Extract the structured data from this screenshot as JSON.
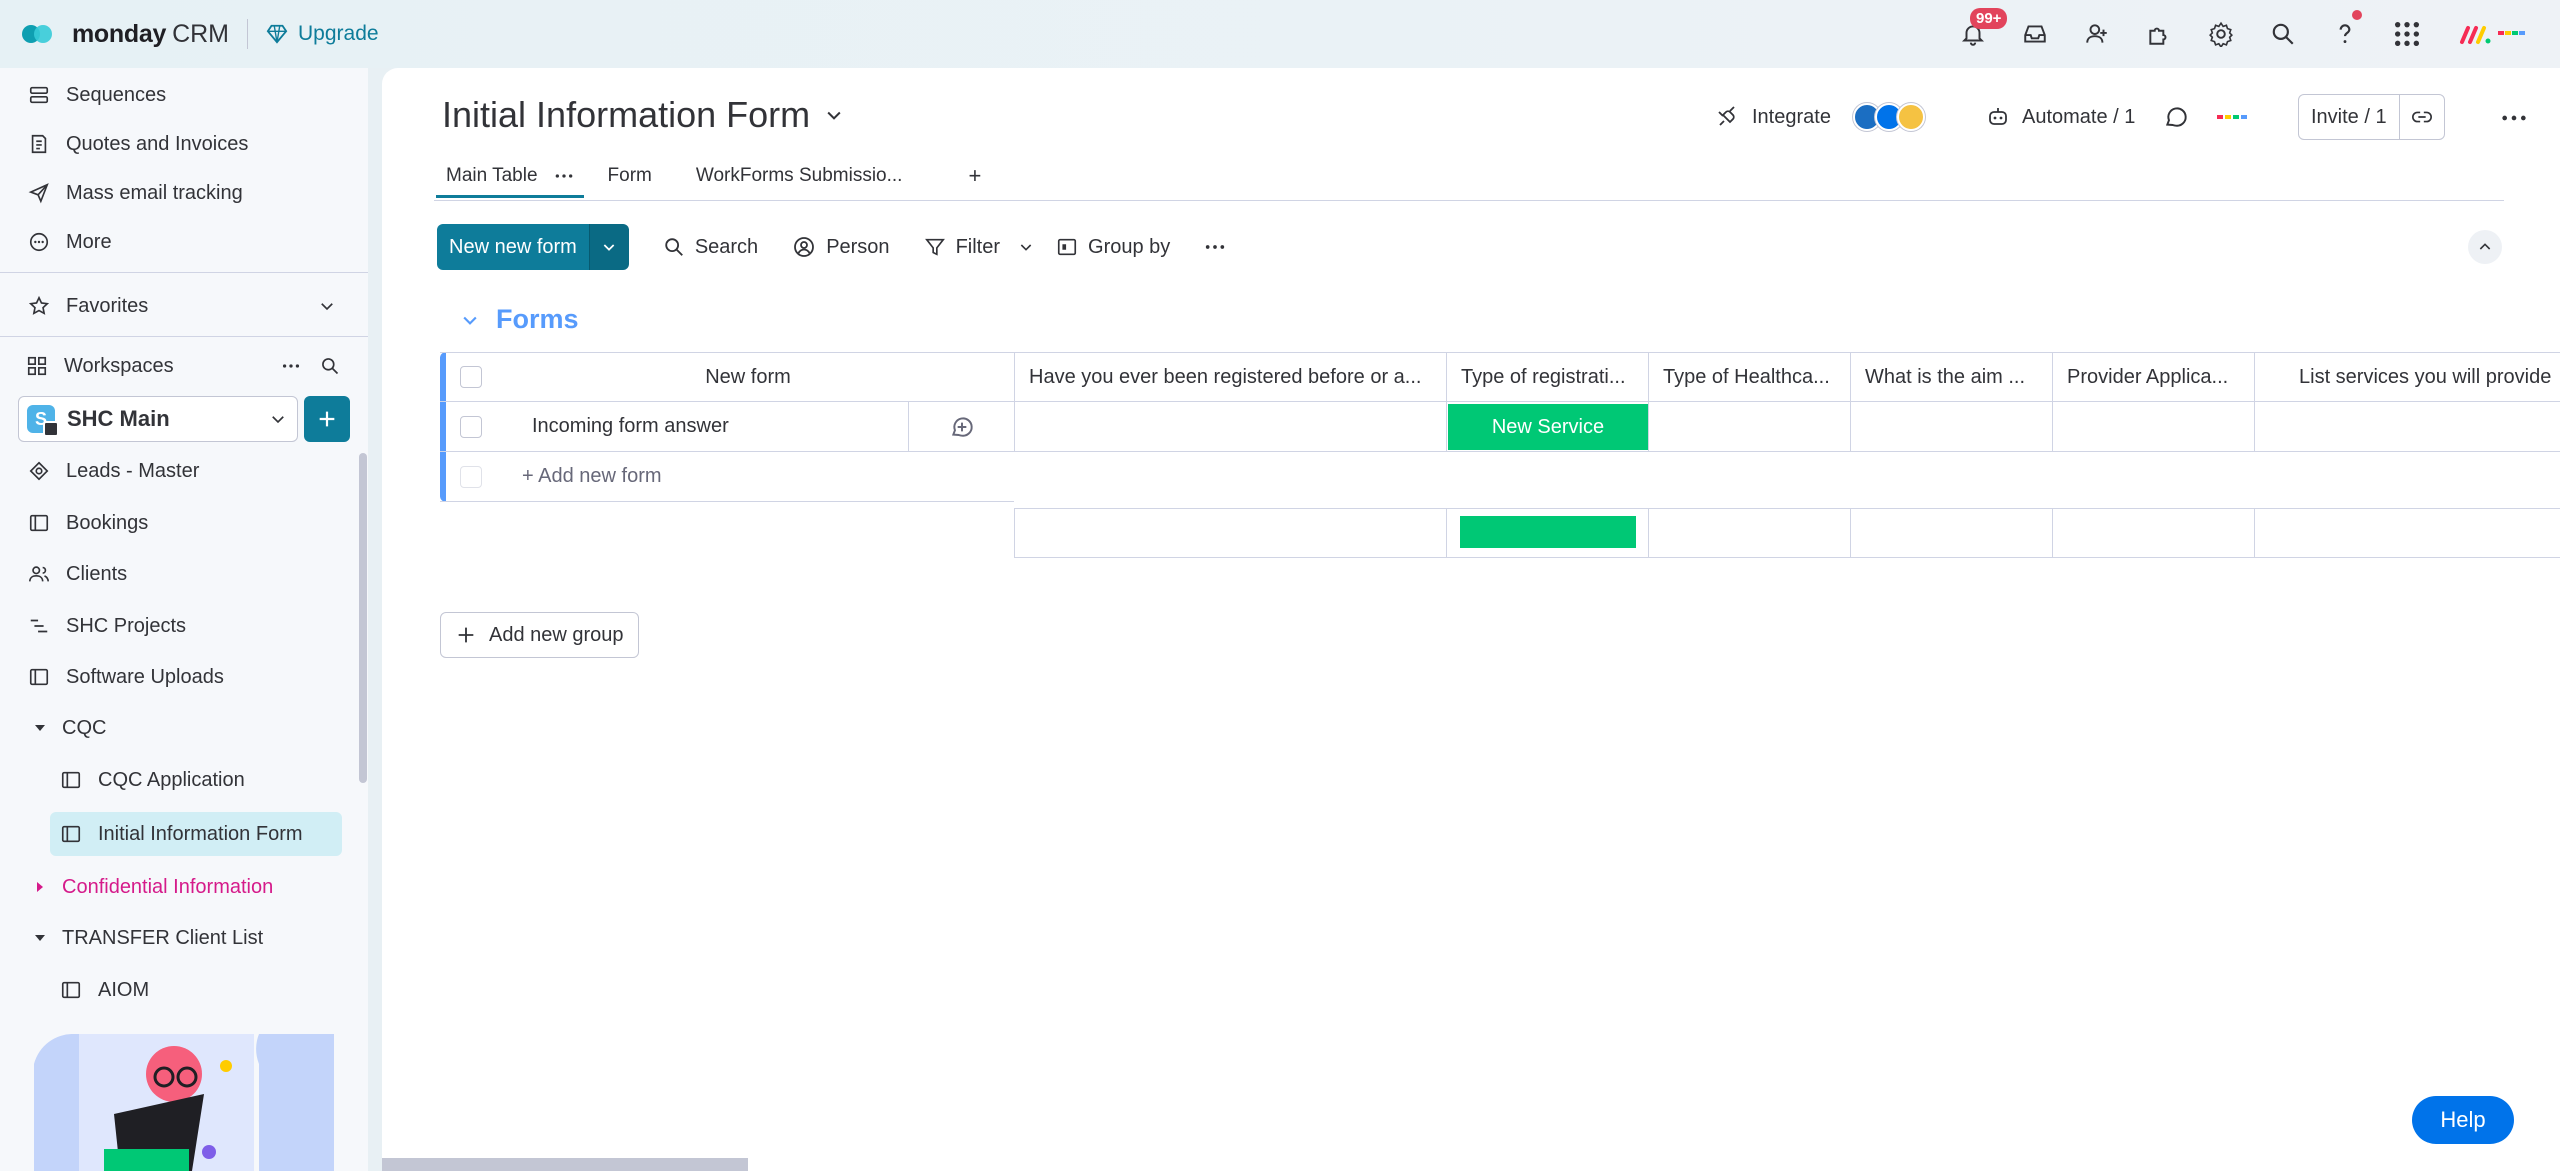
{
  "topbar": {
    "brand_bold": "monday",
    "brand_thin": "CRM",
    "upgrade": "Upgrade",
    "notif_badge": "99+"
  },
  "sidebar": {
    "items_top": [
      {
        "label": "Sequences",
        "icon": "sequence-icon"
      },
      {
        "label": "Quotes and Invoices",
        "icon": "invoice-icon"
      },
      {
        "label": "Mass email tracking",
        "icon": "send-icon"
      },
      {
        "label": "More",
        "icon": "more-circle-icon"
      }
    ],
    "favorites": "Favorites",
    "workspaces": "Workspaces",
    "workspace_name": "SHC Main",
    "workspace_initial": "S",
    "boards": [
      {
        "label": "Leads - Master",
        "icon": "target-icon"
      },
      {
        "label": "Bookings",
        "icon": "board-icon"
      },
      {
        "label": "Clients",
        "icon": "people-icon"
      },
      {
        "label": "SHC Projects",
        "icon": "list-icon"
      },
      {
        "label": "Software Uploads",
        "icon": "board-icon"
      }
    ],
    "folder_cqc": "CQC",
    "cqc_items": [
      {
        "label": "CQC Application"
      },
      {
        "label": "Initial Information Form"
      }
    ],
    "folder_confidential": "Confidential Information",
    "folder_transfer": "TRANSFER Client List",
    "transfer_items": [
      {
        "label": "AIOM"
      }
    ]
  },
  "board": {
    "title": "Initial Information Form",
    "integrate": "Integrate",
    "automate": "Automate / 1",
    "invite": "Invite / 1",
    "tabs": [
      {
        "label": "Main Table"
      },
      {
        "label": "Form"
      },
      {
        "label": "WorkForms Submissio..."
      }
    ],
    "tab_add": "+",
    "toolbar": {
      "new_item": "New new form",
      "search": "Search",
      "person": "Person",
      "filter": "Filter",
      "group_by": "Group by"
    },
    "group_title": "Forms",
    "columns": [
      "New form",
      "Have you ever been registered before or a...",
      "Type of registrati...",
      "Type of Healthca...",
      "What is the aim ...",
      "Provider Applica...",
      "List services you will provide"
    ],
    "rows": [
      {
        "name": "Incoming form answer",
        "status": "New Service"
      }
    ],
    "add_item": "+ Add new form",
    "add_group": "Add new group",
    "colors": {
      "accent": "#0e7c9a",
      "group": "#579bfc",
      "status_green": "#00c875"
    }
  },
  "help": "Help"
}
